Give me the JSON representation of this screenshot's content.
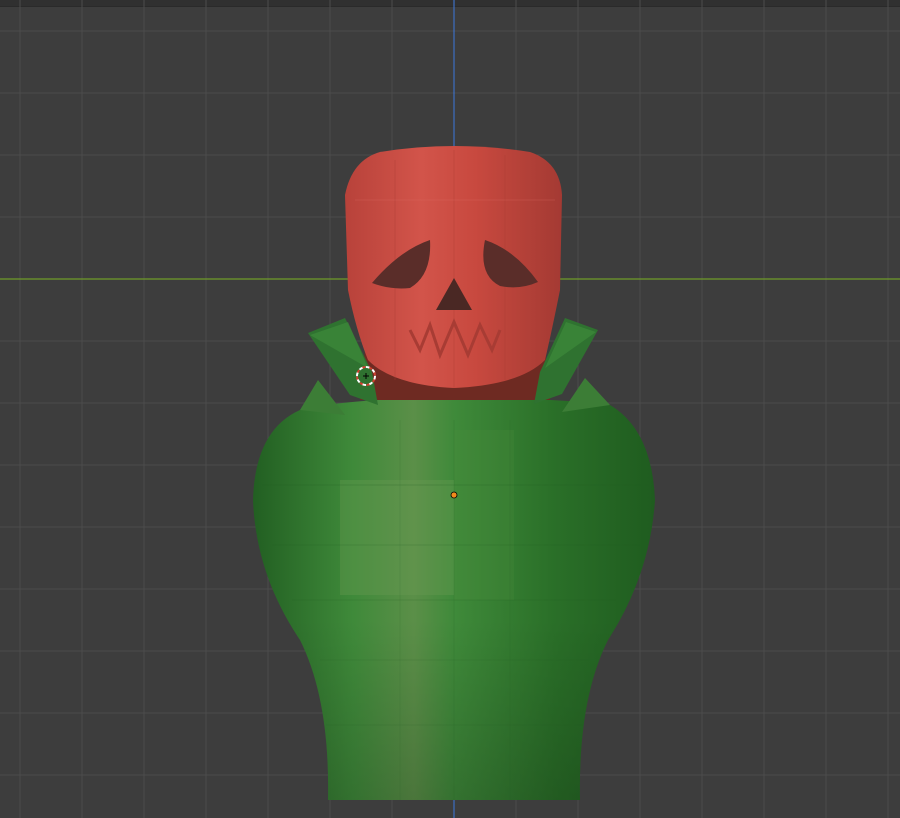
{
  "viewport": {
    "background": "#3d3d3d",
    "grid_color": "#4c4c4c",
    "x_axis_color": "#6f9b2a",
    "z_axis_color": "#3d6fc2"
  },
  "scene": {
    "objects": [
      {
        "name": "skull-head",
        "color": "#cc4a3e"
      },
      {
        "name": "green-vase-body",
        "color": "#2f7a2f"
      },
      {
        "name": "collar",
        "color": "#2f6e2f"
      }
    ],
    "icons": [
      "3d-cursor-icon",
      "object-origin-icon"
    ]
  }
}
